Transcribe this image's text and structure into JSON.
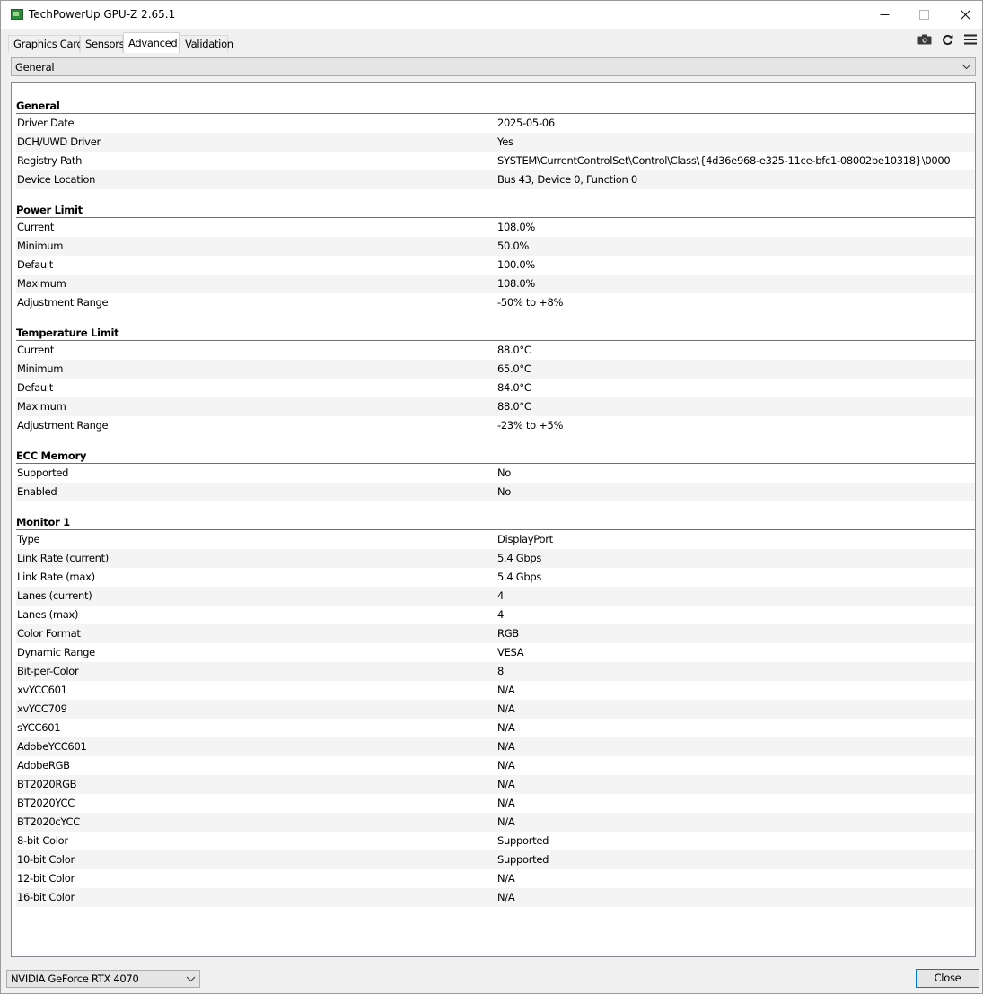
{
  "window": {
    "title": "TechPowerUp GPU-Z 2.65.1"
  },
  "icons": {
    "app": "gpu-z-app-icon",
    "minimize": "minimize-icon",
    "maximize": "maximize-icon",
    "close": "close-icon",
    "camera": "camera-icon",
    "refresh": "refresh-icon",
    "menu": "hamburger-menu-icon",
    "chevron": "chevron-down-icon"
  },
  "tabs": [
    {
      "label": "Graphics Card"
    },
    {
      "label": "Sensors"
    },
    {
      "label": "Advanced"
    },
    {
      "label": "Validation"
    }
  ],
  "category_select": {
    "value": "General"
  },
  "sections": {
    "general": {
      "title": "General",
      "rows": [
        {
          "key": "Driver Date",
          "value": "2025-05-06"
        },
        {
          "key": "DCH/UWD Driver",
          "value": "Yes"
        },
        {
          "key": "Registry Path",
          "value": "SYSTEM\\CurrentControlSet\\Control\\Class\\{4d36e968-e325-11ce-bfc1-08002be10318}\\0000"
        },
        {
          "key": "Device Location",
          "value": "Bus 43, Device 0, Function 0"
        }
      ]
    },
    "power_limit": {
      "title": "Power Limit",
      "rows": [
        {
          "key": "Current",
          "value": "108.0%"
        },
        {
          "key": "Minimum",
          "value": "50.0%"
        },
        {
          "key": "Default",
          "value": "100.0%"
        },
        {
          "key": "Maximum",
          "value": "108.0%"
        },
        {
          "key": "Adjustment Range",
          "value": "-50% to +8%"
        }
      ]
    },
    "temperature_limit": {
      "title": "Temperature Limit",
      "rows": [
        {
          "key": "Current",
          "value": "88.0°C"
        },
        {
          "key": "Minimum",
          "value": "65.0°C"
        },
        {
          "key": "Default",
          "value": "84.0°C"
        },
        {
          "key": "Maximum",
          "value": "88.0°C"
        },
        {
          "key": "Adjustment Range",
          "value": "-23% to +5%"
        }
      ]
    },
    "ecc_memory": {
      "title": "ECC Memory",
      "rows": [
        {
          "key": "Supported",
          "value": "No"
        },
        {
          "key": "Enabled",
          "value": "No"
        }
      ]
    },
    "monitor_1": {
      "title": "Monitor 1",
      "rows": [
        {
          "key": "Type",
          "value": "DisplayPort"
        },
        {
          "key": "Link Rate (current)",
          "value": "5.4 Gbps"
        },
        {
          "key": "Link Rate (max)",
          "value": "5.4 Gbps"
        },
        {
          "key": "Lanes (current)",
          "value": "4"
        },
        {
          "key": "Lanes (max)",
          "value": "4"
        },
        {
          "key": "Color Format",
          "value": "RGB"
        },
        {
          "key": "Dynamic Range",
          "value": "VESA"
        },
        {
          "key": "Bit-per-Color",
          "value": "8"
        },
        {
          "key": "xvYCC601",
          "value": "N/A"
        },
        {
          "key": "xvYCC709",
          "value": "N/A"
        },
        {
          "key": "sYCC601",
          "value": "N/A"
        },
        {
          "key": "AdobeYCC601",
          "value": "N/A"
        },
        {
          "key": "AdobeRGB",
          "value": "N/A"
        },
        {
          "key": "BT2020RGB",
          "value": "N/A"
        },
        {
          "key": "BT2020YCC",
          "value": "N/A"
        },
        {
          "key": "BT2020cYCC",
          "value": "N/A"
        },
        {
          "key": "8-bit Color",
          "value": "Supported"
        },
        {
          "key": "10-bit Color",
          "value": "Supported"
        },
        {
          "key": "12-bit Color",
          "value": "N/A"
        },
        {
          "key": "16-bit Color",
          "value": "N/A"
        }
      ]
    }
  },
  "gpu_select": {
    "value": "NVIDIA GeForce RTX 4070"
  },
  "footer": {
    "close_label": "Close"
  }
}
